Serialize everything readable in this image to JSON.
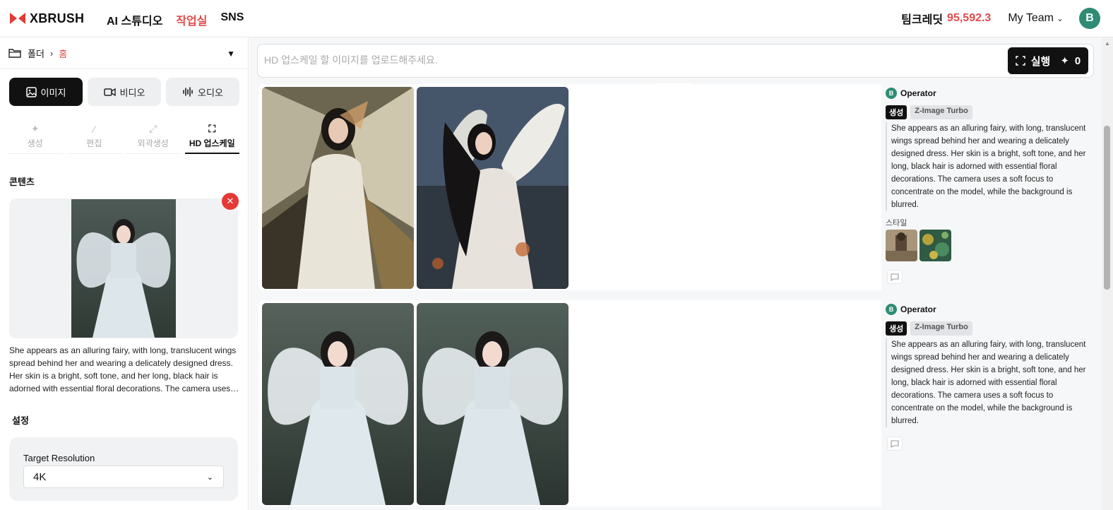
{
  "brand": {
    "name": "XBRUSH",
    "color": "#e53935"
  },
  "nav": {
    "items": [
      "AI 스튜디오",
      "작업실",
      "SNS"
    ],
    "active_index": 1
  },
  "header": {
    "credit_label": "팀크레딧",
    "credit_value": "95,592.3",
    "team": "My Team",
    "avatar_initial": "B"
  },
  "sidebar": {
    "breadcrumb": {
      "folder": "폴더",
      "home": "홈"
    },
    "type_tabs": [
      {
        "label": "이미지",
        "icon": "image-icon",
        "active": true
      },
      {
        "label": "비디오",
        "icon": "video-icon",
        "active": false
      },
      {
        "label": "오디오",
        "icon": "audio-wave-icon",
        "active": false
      }
    ],
    "sub_tabs": [
      {
        "label": "생성",
        "icon": "sparkle-icon"
      },
      {
        "label": "편집",
        "icon": "magic-wand-icon"
      },
      {
        "label": "외곽생성",
        "icon": "expand-icon"
      },
      {
        "label": "HD 업스케일",
        "icon": "upscale-icon"
      }
    ],
    "content_title": "콘텐츠",
    "content_description": "She appears as an alluring fairy, with long, translucent wings spread behind her and wearing a delicately designed dress. Her skin is a bright, soft tone, and her long, black hair is adorned with essential floral decorations. The camera uses a soft focus to concentrate on the model, while the background is blurred.",
    "settings_title": "설정",
    "settings": {
      "target_resolution_label": "Target Resolution",
      "target_resolution_value": "4K"
    }
  },
  "main": {
    "prompt_placeholder": "HD 업스케일 할 이미지를 업로드해주세요.",
    "run_label": "실행",
    "run_cost": "0",
    "results": [
      {
        "operator": "Operator",
        "operator_initial": "B",
        "badge_mode": "생성",
        "badge_model": "Z-Image Turbo",
        "prompt": "She appears as an alluring fairy, with long, translucent wings spread behind her and wearing a delicately designed dress. Her skin is a bright, soft tone, and her long, black hair is adorned with essential floral decorations. The camera uses a soft focus to concentrate on the model, while the background is blurred.",
        "style_label": "스타일"
      },
      {
        "operator": "Operator",
        "operator_initial": "B",
        "badge_mode": "생성",
        "badge_model": "Z-Image Turbo",
        "prompt": "She appears as an alluring fairy, with long, translucent wings spread behind her and wearing a delicately designed dress. Her skin is a bright, soft tone, and her long, black hair is adorned with essential floral decorations. The camera uses a soft focus to concentrate on the model, while the background is blurred."
      }
    ]
  }
}
